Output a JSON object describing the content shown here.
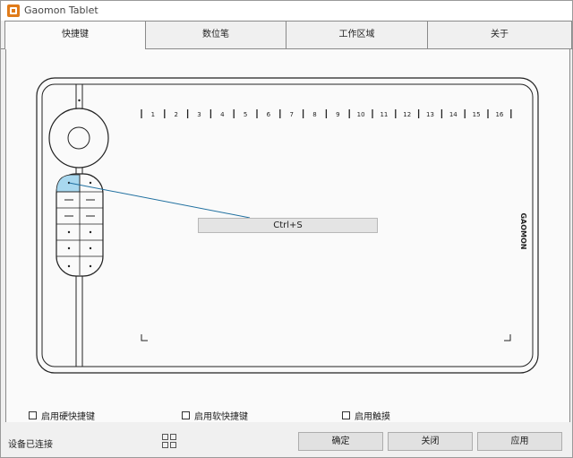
{
  "window": {
    "title": "Gaomon Tablet"
  },
  "tabs": [
    {
      "label": "快捷键",
      "active": true
    },
    {
      "label": "数位笔",
      "active": false
    },
    {
      "label": "工作区域",
      "active": false
    },
    {
      "label": "关于",
      "active": false
    }
  ],
  "tablet": {
    "brand": "GAOMON",
    "express_keys": [
      "1",
      "2",
      "3",
      "4",
      "5",
      "6",
      "7",
      "8",
      "9",
      "10",
      "11",
      "12",
      "13",
      "14",
      "15",
      "16"
    ],
    "selected_key_binding": "Ctrl+S"
  },
  "options": {
    "hard_shortcut": "启用硬快捷键",
    "soft_shortcut": "启用软快捷键",
    "touch": "启用触摸"
  },
  "status": {
    "text": "设备已连接"
  },
  "buttons": {
    "ok": "确定",
    "close": "关闭",
    "apply": "应用"
  },
  "colors": {
    "accent": "#1f6f9f",
    "selected_key": "#a8d8ef"
  }
}
